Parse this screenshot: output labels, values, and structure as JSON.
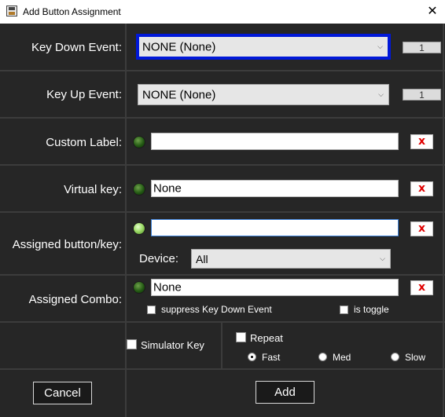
{
  "window": {
    "title": "Add Button Assignment",
    "icon": "app-icon",
    "close_icon": "close-icon"
  },
  "key_down": {
    "label": "Key Down Event:",
    "value": "NONE (None)",
    "count": "1"
  },
  "key_up": {
    "label": "Key Up Event:",
    "value": "NONE (None)",
    "count": "1"
  },
  "custom_label": {
    "label": "Custom Label:",
    "value": "",
    "clear": "x"
  },
  "virtual_key": {
    "label": "Virtual key:",
    "value": "None",
    "clear": "x"
  },
  "assigned_button": {
    "label": "Assigned button/key:",
    "value": "",
    "clear": "x",
    "device_label": "Device:",
    "device_value": "All"
  },
  "assigned_combo": {
    "label": "Assigned Combo:",
    "value": "None",
    "clear": "x",
    "suppress_label": "suppress Key Down Event",
    "toggle_label": "is toggle"
  },
  "options": {
    "simulator_key_label": "Simulator Key",
    "repeat_label": "Repeat",
    "speeds": [
      {
        "label": "Fast",
        "checked": true
      },
      {
        "label": "Med",
        "checked": false
      },
      {
        "label": "Slow",
        "checked": false
      }
    ]
  },
  "buttons": {
    "cancel": "Cancel",
    "add": "Add"
  },
  "colors": {
    "background": "#262626",
    "focus_border": "#0018d8",
    "clear_x": "#e00000",
    "led_off": "#245a14",
    "led_on": "#9fdc6a"
  }
}
